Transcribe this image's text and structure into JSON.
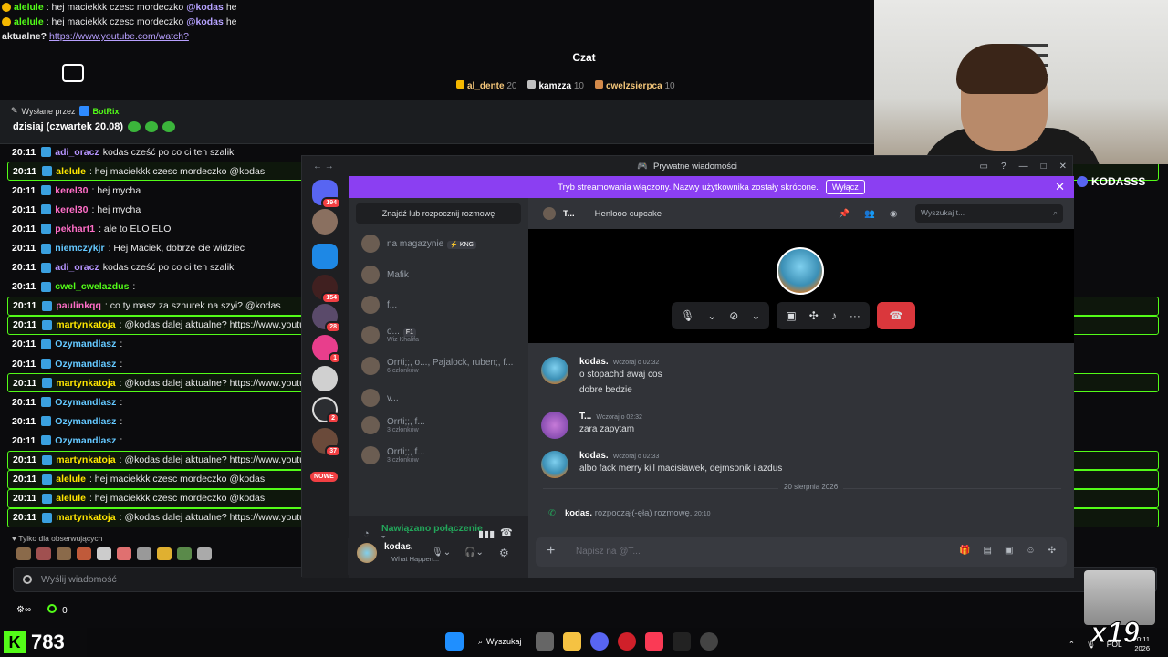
{
  "top_chat": [
    {
      "user": "alelule",
      "text": ": hej maciekkk czesc mordeczko",
      "mention": "@kodas",
      "tail": "he"
    },
    {
      "user": "alelule",
      "text": ": hej maciekkk czesc mordeczko",
      "mention": "@kodas",
      "tail": "he"
    },
    {
      "prefix": "aktualne?",
      "link": "https://www.youtube.com/watch?"
    }
  ],
  "chat_title": "Czat",
  "top_gifters": [
    {
      "name": "al_dente",
      "count": "20",
      "color": "#f5b800"
    },
    {
      "name": "kamzza",
      "count": "10",
      "color": "#c0c0c0"
    },
    {
      "name": "cwelzsierpca",
      "count": "10",
      "color": "#d38a4a"
    }
  ],
  "pinned": {
    "sent_by": "Wysłane przez",
    "bot": "BotRix",
    "message": "dzisiaj (czwartek 20.08)"
  },
  "chat_messages": [
    {
      "time": "20:11",
      "user": "adi_oracz",
      "color": "c-purple",
      "text": "kodas cześć po co ci ten szalik",
      "hl": false
    },
    {
      "time": "20:11",
      "user": "alelule",
      "color": "c-yellow",
      "text": ": hej maciekkk czesc mordeczko @kodas",
      "hl": true
    },
    {
      "time": "20:11",
      "user": "kerel30",
      "color": "c-pink",
      "text": ": hej mycha",
      "hl": false
    },
    {
      "time": "20:11",
      "user": "kerel30",
      "color": "c-pink",
      "text": ": hej mycha",
      "hl": false
    },
    {
      "time": "20:11",
      "user": "pekhart1",
      "color": "c-pink",
      "text": ": ale to ELO ELO",
      "hl": false
    },
    {
      "time": "20:11",
      "user": "niemczykjr",
      "color": "c-blue",
      "text": ": Hej Maciek, dobrze cie widziec",
      "hl": false
    },
    {
      "time": "20:11",
      "user": "adi_oracz",
      "color": "c-purple",
      "text": "kodas cześć po co ci ten szalik",
      "hl": false
    },
    {
      "time": "20:11",
      "user": "cwel_cwelazdus",
      "color": "c-green",
      "text": ":",
      "hl": false
    },
    {
      "time": "20:11",
      "user": "paulinkqq",
      "color": "c-pink",
      "text": ": co ty masz za sznurek na szyi? @kodas",
      "hl": true
    },
    {
      "time": "20:11",
      "user": "martynkatoja",
      "color": "c-yellow",
      "text": ": @kodas dalej aktualne? https://www.youtub",
      "hl": true
    },
    {
      "time": "20:11",
      "user": "Ozymandlasz",
      "color": "c-blue",
      "text": ":",
      "hl": false
    },
    {
      "time": "20:11",
      "user": "Ozymandlasz",
      "color": "c-blue",
      "text": ":",
      "hl": false
    },
    {
      "time": "20:11",
      "user": "martynkatoja",
      "color": "c-yellow",
      "text": ": @kodas dalej aktualne? https://www.youtub",
      "hl": true
    },
    {
      "time": "20:11",
      "user": "Ozymandlasz",
      "color": "c-blue",
      "text": ":",
      "hl": false
    },
    {
      "time": "20:11",
      "user": "Ozymandlasz",
      "color": "c-blue",
      "text": ":",
      "hl": false
    },
    {
      "time": "20:11",
      "user": "Ozymandlasz",
      "color": "c-blue",
      "text": ":",
      "hl": false
    },
    {
      "time": "20:11",
      "user": "martynkatoja",
      "color": "c-yellow",
      "text": ": @kodas dalej aktualne? https://www.youtub",
      "hl": true
    },
    {
      "time": "20:11",
      "user": "alelule",
      "color": "c-yellow",
      "text": ": hej maciekkk czesc mordeczko @kodas",
      "hl": true
    },
    {
      "time": "20:11",
      "user": "alelule",
      "color": "c-yellow",
      "text": ": hej maciekkk czesc mordeczko @kodas",
      "hl": true
    },
    {
      "time": "20:11",
      "user": "martynkatoja",
      "color": "c-yellow",
      "text": ": @kodas dalej aktualne? https://www.youtub",
      "hl": true
    }
  ],
  "followers_only": "Tylko dla obserwujących",
  "chat_input_placeholder": "Wyślij wiadomość",
  "viewer_row": {
    "symbol": "∞",
    "count": "0"
  },
  "stream_name": "KODASSS",
  "discord": {
    "window_title": "Prywatne wiadomości",
    "banner_text": "Tryb streamowania włączony. Nazwy użytkownika zostały skrócone.",
    "banner_button": "Wyłącz",
    "find_conversation": "Znajdź lub rozpocznij rozmowę",
    "server_badges": [
      "194",
      "154",
      "28",
      "1",
      "2",
      "37"
    ],
    "new_label": "NOWE",
    "dms": [
      {
        "name": "na magazynie",
        "tag": "⚡ KNG",
        "sub": ""
      },
      {
        "name": "Mafik",
        "tag": "",
        "sub": ""
      },
      {
        "name": "f...",
        "tag": "",
        "sub": ""
      },
      {
        "name": "o...",
        "tag": "F1",
        "sub": "Wiz Khalifa"
      },
      {
        "name": "Orrti;;, o..., Pajalock, ruben;, f...",
        "tag": "",
        "sub": "6 członków"
      },
      {
        "name": "v...",
        "tag": "",
        "sub": ""
      },
      {
        "name": "Orrti;;, f...",
        "tag": "",
        "sub": "3 członków"
      },
      {
        "name": "Orrti;;, f...",
        "tag": "",
        "sub": "3 członków"
      }
    ],
    "voice_connected": "Nawiązano połączenie",
    "voice_channel": "T...",
    "user_name": "kodas.",
    "user_status": "What Happen...",
    "header_name": "T...",
    "header_topic": "Henlooo cupcake",
    "header_search": "Wyszukaj t...",
    "messages": [
      {
        "author": "kodas.",
        "time": "Wczoraj o 02:32",
        "lines": [
          "o stopachd awaj cos",
          "dobre bedzie"
        ]
      },
      {
        "author": "T...",
        "time": "Wczoraj o 02:32",
        "lines": [
          "zara zapytam"
        ]
      },
      {
        "author": "kodas.",
        "time": "Wczoraj o 02:33",
        "lines": [
          "albo fack merry kill macisławek, dejmsonik i azdus"
        ]
      }
    ],
    "date_divider": "20 sierpnia 2026",
    "system_user": "kodas.",
    "system_text": "rozpoczął(-ęła) rozmowę.",
    "system_time": "20:10",
    "composer_placeholder": "Napisz na @T..."
  },
  "taskbar": {
    "kick_count": "783",
    "search": "Wyszukaj",
    "lang": "POL",
    "time": "20:11",
    "year": "2026"
  },
  "overlay_multiplier": "x19"
}
